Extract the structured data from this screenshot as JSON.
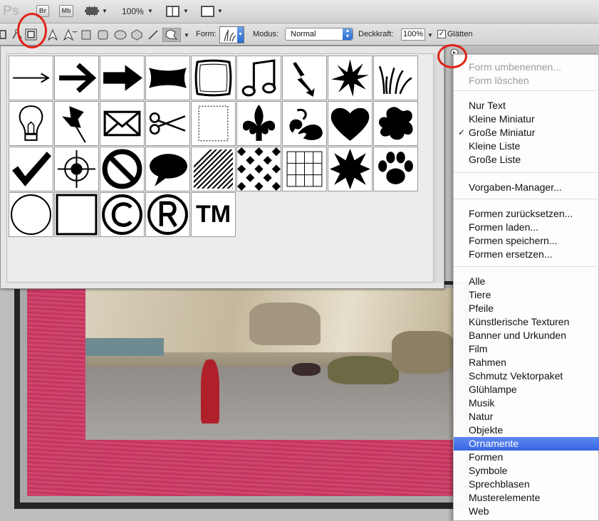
{
  "app": {
    "logo": "Ps",
    "bridge_label": "Br",
    "minibridge_label": "Mb",
    "zoom": "100%"
  },
  "options_bar": {
    "form_label": "Form:",
    "mode_label": "Modus:",
    "mode_value": "Normal",
    "opacity_label": "Deckkraft:",
    "opacity_value": "100%",
    "antialias_label": "Glätten",
    "antialias_checked": "✓"
  },
  "shapes": [
    "arrow-thin-icon",
    "arrow-bold-icon",
    "arrow-block-icon",
    "banner-icon",
    "frame-icon",
    "music-note-icon",
    "lightning-icon",
    "star-burst-icon",
    "grass-icon",
    "lightbulb-icon",
    "pushpin-icon",
    "envelope-icon",
    "scissors-icon",
    "stamp-frame-icon",
    "fleur-de-lis-icon",
    "ornament-icon",
    "heart-icon",
    "splat-icon",
    "checkmark-icon",
    "crosshair-icon",
    "no-sign-icon",
    "speech-bubble-icon",
    "diagonal-lines-icon",
    "diamond-grid-icon",
    "grid-icon",
    "star-spiky-icon",
    "paw-icon",
    "circle-icon",
    "square-icon",
    "copyright-icon",
    "registered-icon",
    "trademark-icon"
  ],
  "trademark_text": "TM",
  "menu": {
    "items": [
      {
        "label": "Form umbenennen...",
        "disabled": true
      },
      {
        "label": "Form löschen",
        "disabled": true
      },
      {
        "label": "Nur Text"
      },
      {
        "label": "Kleine Miniatur"
      },
      {
        "label": "Große Miniatur",
        "checked": "✓"
      },
      {
        "label": "Kleine Liste"
      },
      {
        "label": "Große Liste"
      },
      {
        "label": "Vorgaben-Manager..."
      },
      {
        "label": "Formen zurücksetzen..."
      },
      {
        "label": "Formen laden..."
      },
      {
        "label": "Formen speichern..."
      },
      {
        "label": "Formen ersetzen..."
      },
      {
        "label": "Alle"
      },
      {
        "label": "Tiere"
      },
      {
        "label": "Pfeile"
      },
      {
        "label": "Künstlerische Texturen"
      },
      {
        "label": "Banner und Urkunden"
      },
      {
        "label": "Film"
      },
      {
        "label": "Rahmen"
      },
      {
        "label": "Schmutz Vektorpaket"
      },
      {
        "label": "Glühlampe"
      },
      {
        "label": "Musik"
      },
      {
        "label": "Natur"
      },
      {
        "label": "Objekte"
      },
      {
        "label": "Ornamente",
        "selected": true
      },
      {
        "label": "Formen"
      },
      {
        "label": "Symbole"
      },
      {
        "label": "Sprechblasen"
      },
      {
        "label": "Musterelemente"
      },
      {
        "label": "Web"
      }
    ]
  },
  "colors": {
    "highlight": "#e02318",
    "selection": "#3866e3",
    "frame_pink": "#c7355f"
  }
}
